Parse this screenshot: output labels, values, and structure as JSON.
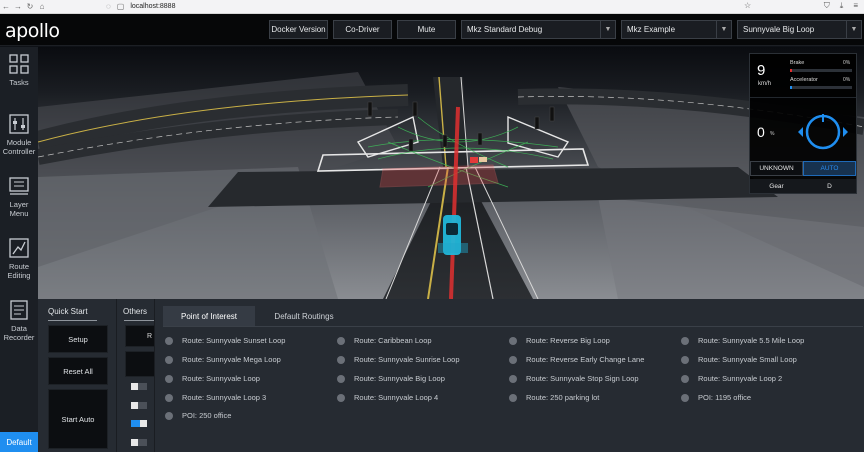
{
  "browser": {
    "url": "localhost:8888"
  },
  "app": {
    "logo": "apollo"
  },
  "header": {
    "docker_version": "Docker Version",
    "co_driver": "Co-Driver",
    "mute": "Mute",
    "mode_select": "Mkz Standard Debug",
    "vehicle_select": "Mkz Example",
    "map_select": "Sunnyvale Big Loop"
  },
  "sidebar": {
    "items": [
      {
        "label": "Tasks",
        "icon": "grid-icon"
      },
      {
        "label": "Module\nController",
        "icon": "sliders-icon"
      },
      {
        "label": "Layer\nMenu",
        "icon": "layers-icon"
      },
      {
        "label": "Route\nEditing",
        "icon": "route-icon"
      },
      {
        "label": "Data\nRecorder",
        "icon": "document-icon"
      }
    ],
    "default_label": "Default"
  },
  "dashboard": {
    "speed": "9",
    "speed_unit": "km/h",
    "brake_label": "Brake",
    "brake_value": "0%",
    "brake_level": 0.04,
    "accelerator_label": "Accelerator",
    "accelerator_value": "0%",
    "accelerator_level": 0.04,
    "steering_angle": "0",
    "steering_unit": "%",
    "mode_unknown": "UNKNOWN",
    "mode_auto": "AUTO",
    "gear_label": "Gear",
    "gear_value": "D"
  },
  "quick_start": {
    "title": "Quick Start",
    "setup": "Setup",
    "reset_all": "Reset All",
    "start_auto": "Start Auto"
  },
  "others": {
    "title": "Others",
    "box_label": "R",
    "toggles": [
      false,
      false,
      true,
      false
    ]
  },
  "poi_panel": {
    "tabs": [
      "Point of Interest",
      "Default Routings"
    ],
    "routes": [
      [
        "Route: Sunnyvale Sunset Loop",
        "Route: Caribbean Loop",
        "Route: Reverse Big Loop",
        "Route: Sunnyvale 5.5 Mile Loop"
      ],
      [
        "Route: Sunnyvale Mega Loop",
        "Route: Sunnyvale Sunrise Loop",
        "Route: Reverse Early Change Lane",
        "Route: Sunnyvale Small Loop"
      ],
      [
        "Route: Sunnyvale Loop",
        "Route: Sunnyvale Big Loop",
        "Route: Sunnyvale Stop Sign Loop",
        "Route: Sunnyvale Loop 2"
      ],
      [
        "Route: Sunnyvale Loop 3",
        "Route: Sunnyvale Loop 4",
        "Route: 250 parking lot",
        "POI: 1195 office"
      ],
      [
        "POI: 250 office"
      ]
    ]
  },
  "colors": {
    "accent": "#1f8ef0",
    "route_line": "#e03030",
    "ego_car": "#21b6d8"
  }
}
